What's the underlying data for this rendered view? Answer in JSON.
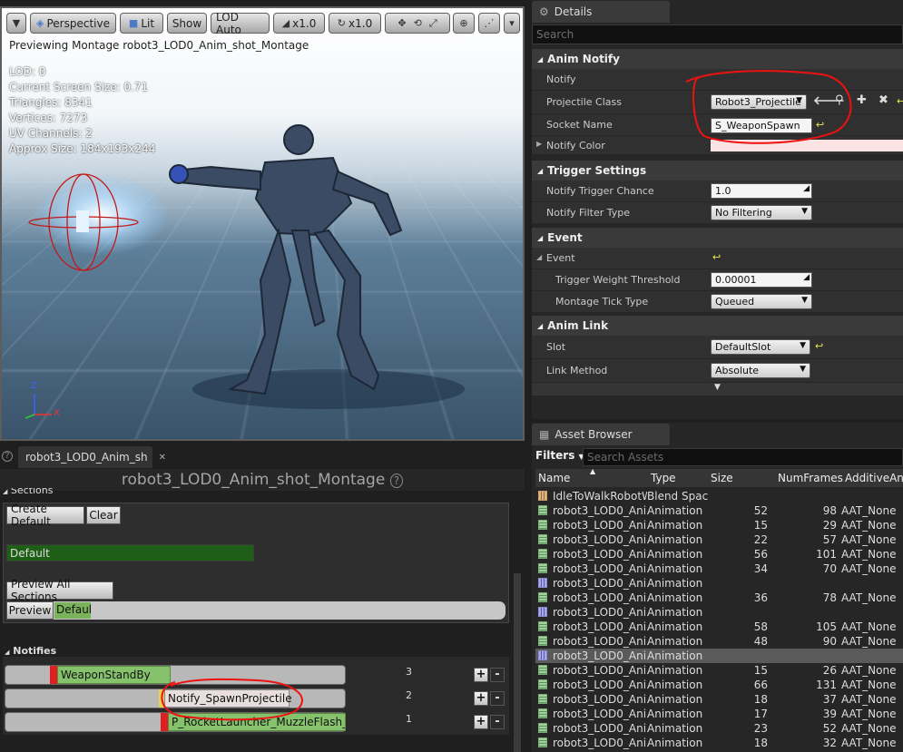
{
  "viewport": {
    "toolbar": {
      "menu_icon": "chevron-down-icon",
      "perspective_label": "Perspective",
      "lit_label": "Lit",
      "show_label": "Show",
      "lod_label": "LOD Auto",
      "speed1_label": "x1.0",
      "speed2_label": "x1.0"
    },
    "preview_text": "Previewing Montage robot3_LOD0_Anim_shot_Montage",
    "stats": [
      "LOD: 0",
      "Current Screen Size: 0.71",
      "Triangles: 8341",
      "Vertices: 7273",
      "UV Channels: 2",
      "Approx Size: 184x193x244"
    ],
    "axis": {
      "z": "Z",
      "x": "X"
    }
  },
  "details": {
    "tab_label": "Details",
    "search_placeholder": "Search",
    "anim_notify": {
      "header": "Anim Notify",
      "notify_label": "Notify",
      "projectile_class_label": "Projectile Class",
      "projectile_class_value": "Robot3_Projectile",
      "socket_name_label": "Socket Name",
      "socket_name_value": "S_WeaponSpawn",
      "notify_color_label": "Notify Color",
      "notify_color": "#fbe3e3"
    },
    "trigger_settings": {
      "header": "Trigger Settings",
      "chance_label": "Notify Trigger Chance",
      "chance_value": "1.0",
      "filter_label": "Notify Filter Type",
      "filter_value": "No Filtering"
    },
    "event": {
      "header": "Event",
      "event_label": "Event",
      "threshold_label": "Trigger Weight Threshold",
      "threshold_value": "0.00001",
      "tick_label": "Montage Tick Type",
      "tick_value": "Queued"
    },
    "anim_link": {
      "header": "Anim Link",
      "slot_label": "Slot",
      "slot_value": "DefaultSlot",
      "link_label": "Link Method",
      "link_value": "Absolute"
    }
  },
  "asset_browser": {
    "tab_label": "Asset Browser",
    "filters_label": "Filters",
    "search_placeholder": "Search Assets",
    "columns": {
      "name": "Name",
      "type": "Type",
      "size": "Size",
      "frames": "NumFrames",
      "additive": "AdditiveAnim"
    },
    "rows": [
      {
        "name": "IdleToWalkRobotW",
        "type": "Blend Spac",
        "size": "",
        "frames": "",
        "additive": "",
        "icon": "blend"
      },
      {
        "name": "robot3_LOD0_Anir",
        "type": "Animation",
        "size": "52",
        "frames": "98",
        "additive": "AAT_None",
        "icon": "anim"
      },
      {
        "name": "robot3_LOD0_Anir",
        "type": "Animation",
        "size": "15",
        "frames": "29",
        "additive": "AAT_None",
        "icon": "anim"
      },
      {
        "name": "robot3_LOD0_Anir",
        "type": "Animation",
        "size": "22",
        "frames": "57",
        "additive": "AAT_None",
        "icon": "anim"
      },
      {
        "name": "robot3_LOD0_Anir",
        "type": "Animation",
        "size": "56",
        "frames": "101",
        "additive": "AAT_None",
        "icon": "anim"
      },
      {
        "name": "robot3_LOD0_Anir",
        "type": "Animation",
        "size": "34",
        "frames": "70",
        "additive": "AAT_None",
        "icon": "anim"
      },
      {
        "name": "robot3_LOD0_Anir",
        "type": "Animation",
        "size": "",
        "frames": "",
        "additive": "",
        "icon": "montage"
      },
      {
        "name": "robot3_LOD0_Anir",
        "type": "Animation",
        "size": "36",
        "frames": "78",
        "additive": "AAT_None",
        "icon": "anim"
      },
      {
        "name": "robot3_LOD0_Anir",
        "type": "Animation",
        "size": "",
        "frames": "",
        "additive": "",
        "icon": "montage"
      },
      {
        "name": "robot3_LOD0_Anir",
        "type": "Animation",
        "size": "58",
        "frames": "105",
        "additive": "AAT_None",
        "icon": "anim"
      },
      {
        "name": "robot3_LOD0_Anir",
        "type": "Animation",
        "size": "48",
        "frames": "90",
        "additive": "AAT_None",
        "icon": "anim"
      },
      {
        "name": "robot3_LOD0_Anir",
        "type": "Animation",
        "size": "",
        "frames": "",
        "additive": "",
        "icon": "montage",
        "selected": true
      },
      {
        "name": "robot3_LOD0_Anir",
        "type": "Animation",
        "size": "15",
        "frames": "26",
        "additive": "AAT_None",
        "icon": "anim"
      },
      {
        "name": "robot3_LOD0_Anir",
        "type": "Animation",
        "size": "66",
        "frames": "131",
        "additive": "AAT_None",
        "icon": "anim"
      },
      {
        "name": "robot3_LOD0_Anir",
        "type": "Animation",
        "size": "18",
        "frames": "37",
        "additive": "AAT_None",
        "icon": "anim"
      },
      {
        "name": "robot3_LOD0_Anir",
        "type": "Animation",
        "size": "17",
        "frames": "39",
        "additive": "AAT_None",
        "icon": "anim"
      },
      {
        "name": "robot3_LOD0_Anir",
        "type": "Animation",
        "size": "23",
        "frames": "52",
        "additive": "AAT_None",
        "icon": "anim"
      },
      {
        "name": "robot3_LOD0_Anir",
        "type": "Animation",
        "size": "18",
        "frames": "32",
        "additive": "AAT_None",
        "icon": "anim"
      }
    ]
  },
  "montage": {
    "tab_label": "robot3_LOD0_Anim_sh",
    "title": "robot3_LOD0_Anim_shot_Montage",
    "sections_header": "Sections",
    "create_default_label": "Create Default",
    "clear_label": "Clear",
    "default_section_label": "Default",
    "preview_all_label": "Preview All Sections",
    "preview_label": "Preview",
    "preview_section_label": "Defaul",
    "notifies_header": "Notifies",
    "notifies": [
      {
        "label": "WeaponStandBy",
        "track_number": "3"
      },
      {
        "label": "Notify_SpawnProjectile",
        "track_number": "2"
      },
      {
        "label": "P_RocketLauncher_MuzzleFlash_F",
        "track_number": "1"
      }
    ]
  }
}
